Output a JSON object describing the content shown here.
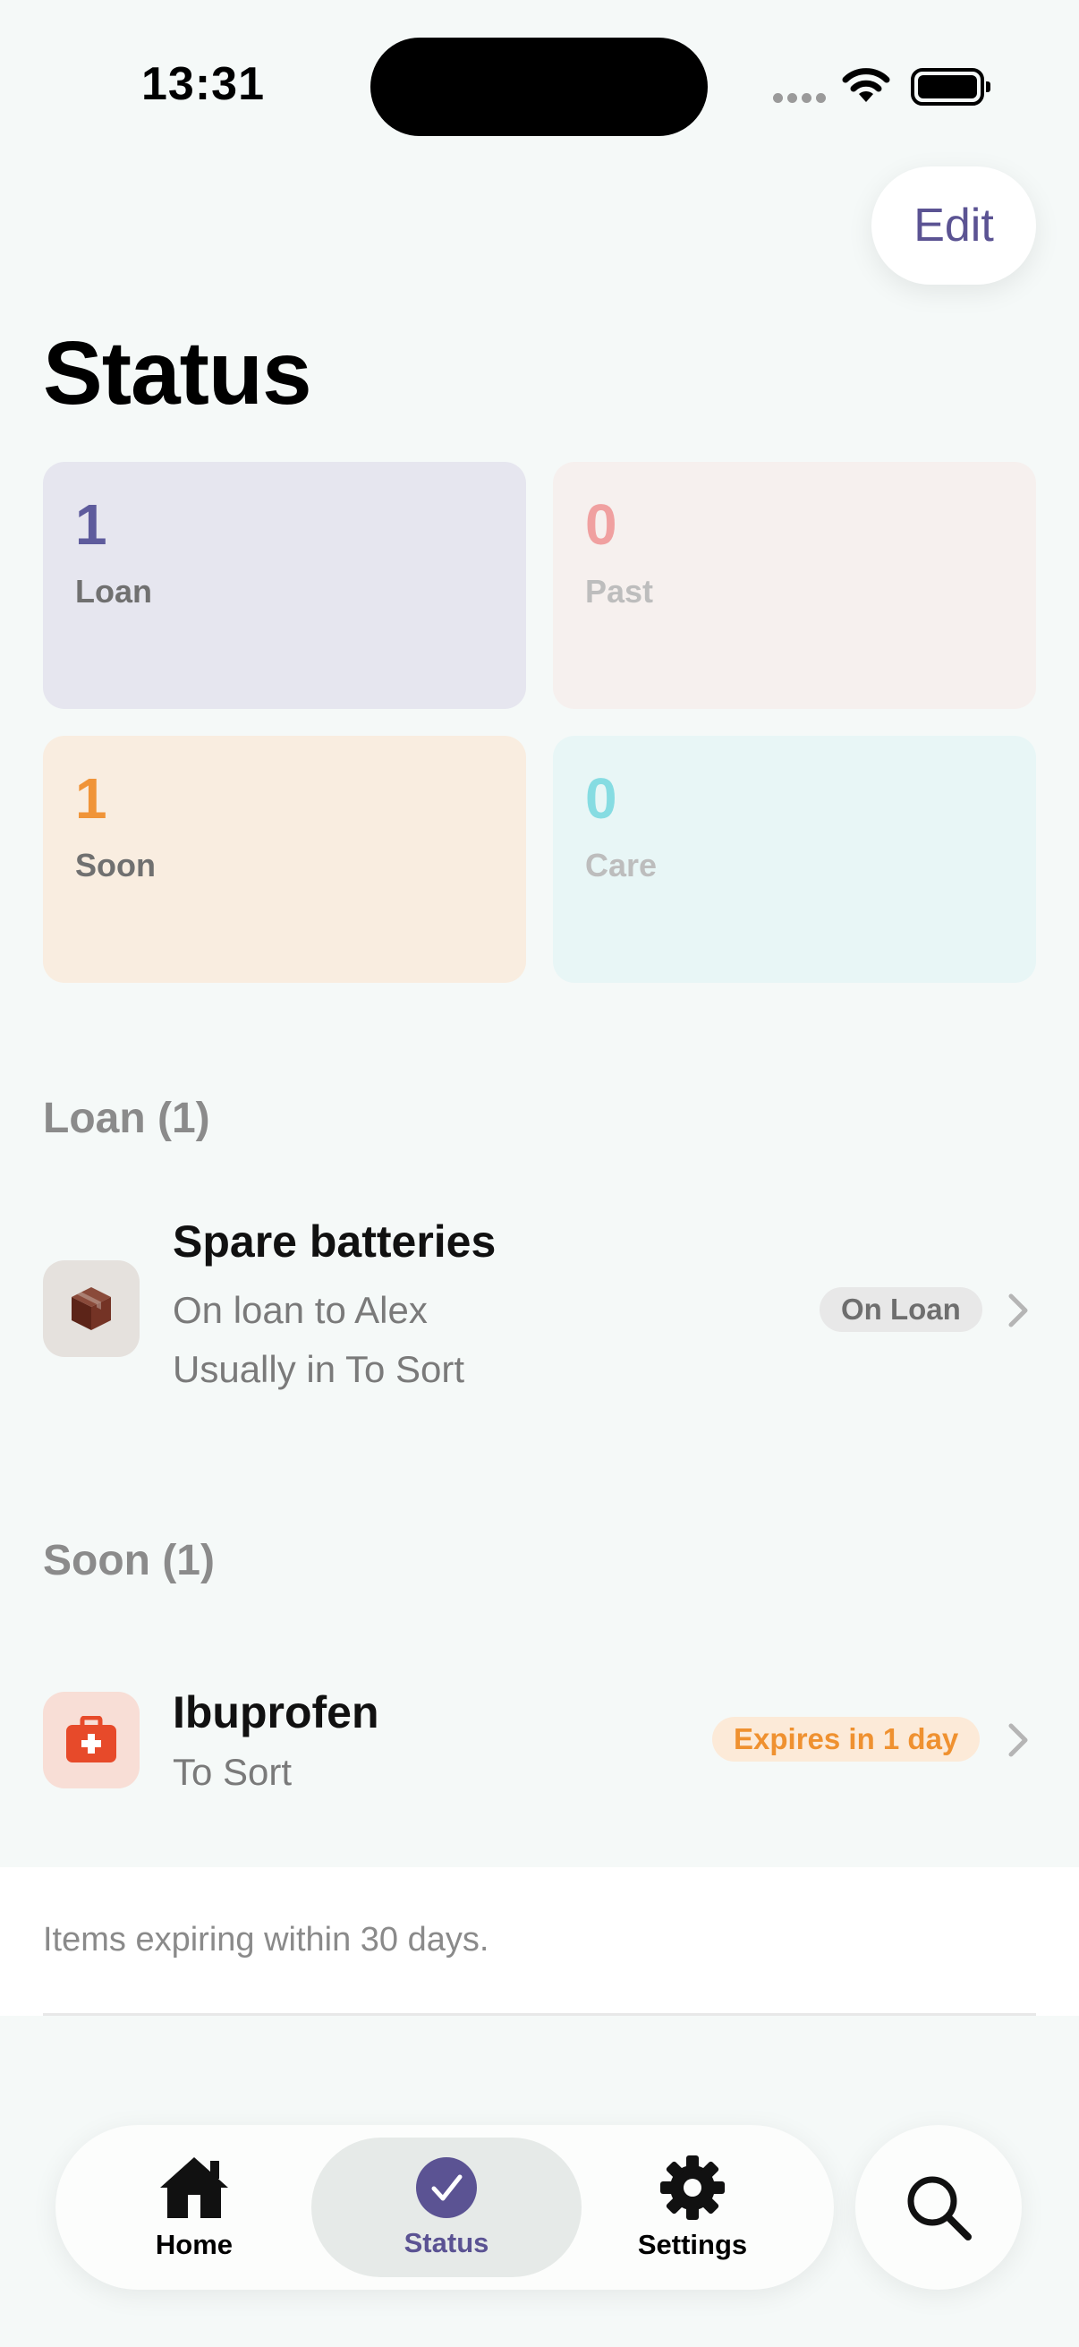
{
  "status_bar": {
    "time": "13:31"
  },
  "header": {
    "edit_label": "Edit",
    "title": "Status"
  },
  "summary": [
    {
      "count": "1",
      "label": "Loan"
    },
    {
      "count": "0",
      "label": "Past"
    },
    {
      "count": "1",
      "label": "Soon"
    },
    {
      "count": "0",
      "label": "Care"
    }
  ],
  "sections": {
    "loan": {
      "header": "Loan (1)",
      "item": {
        "title": "Spare batteries",
        "line1": "On loan to Alex",
        "line2": "Usually in To Sort",
        "badge": "On Loan",
        "icon": "box-icon"
      }
    },
    "soon": {
      "header": "Soon (1)",
      "item": {
        "title": "Ibuprofen",
        "line1": "To Sort",
        "badge": "Expires in 1 day",
        "icon": "medkit-icon"
      }
    }
  },
  "footer": {
    "note": "Items expiring within 30 days."
  },
  "tabbar": {
    "home": "Home",
    "status": "Status",
    "settings": "Settings",
    "active": "Status"
  },
  "colors": {
    "accent": "#5B5393",
    "loan": "#5E5B9C",
    "past": "#F0A0A0",
    "soon": "#F09438",
    "care": "#86DCE2"
  }
}
